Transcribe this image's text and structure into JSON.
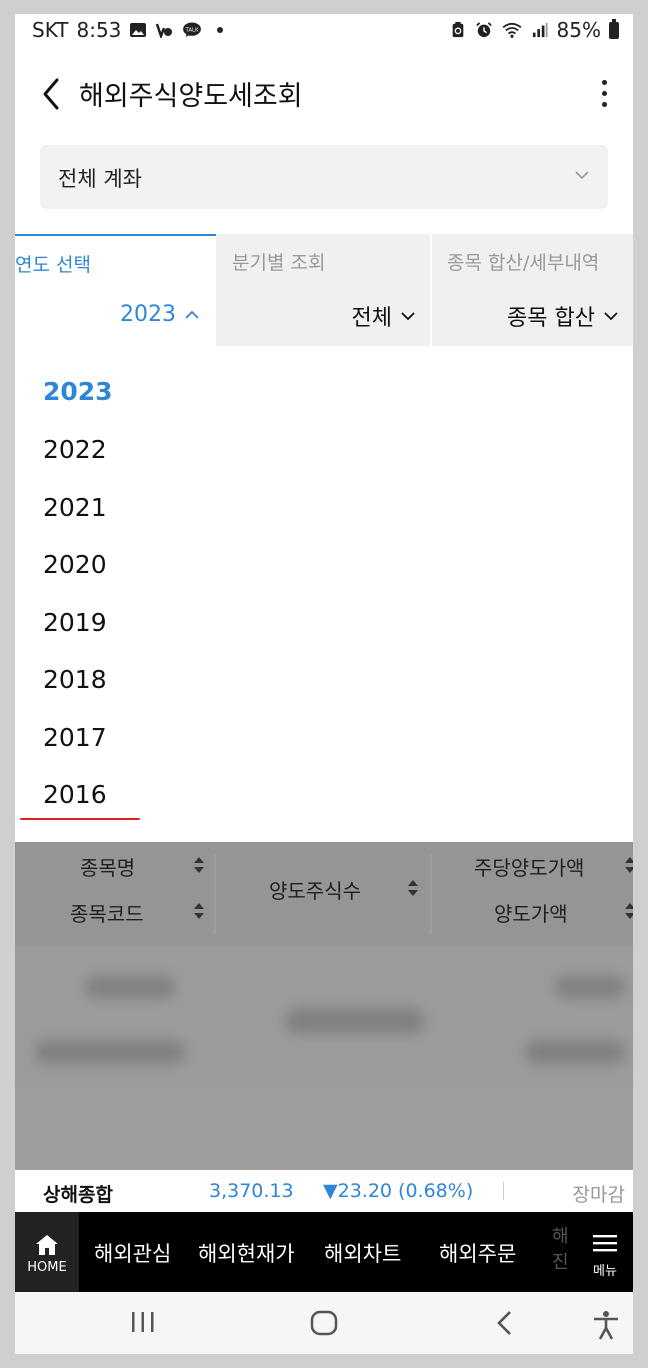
{
  "status_bar": {
    "carrier": "SKT",
    "time": "8:53",
    "battery": "85%"
  },
  "header": {
    "title": "해외주식양도세조회"
  },
  "account_select": {
    "label": "전체 계좌"
  },
  "filters": {
    "year": {
      "label": "연도 선택",
      "value": "2023"
    },
    "quarter": {
      "label": "분기별 조회",
      "value": "전체"
    },
    "item": {
      "label": "종목 합산/세부내역",
      "value": "종목 합산"
    }
  },
  "year_dropdown": {
    "selected": "2023",
    "options": [
      "2023",
      "2022",
      "2021",
      "2020",
      "2019",
      "2018",
      "2017",
      "2016"
    ]
  },
  "table": {
    "headers": {
      "name": "종목명",
      "code": "종목코드",
      "shares": "양도주식수",
      "price_per_share": "주당양도가액",
      "amount": "양도가액"
    }
  },
  "ticker": {
    "name": "상해종합",
    "value": "3,370.13",
    "change": "▼23.20 (0.68%)",
    "status": "장마감",
    "color": "#2f86d6"
  },
  "bottom_nav": {
    "home": "HOME",
    "items": [
      "해외관심",
      "해외현재가",
      "해외차트",
      "해외주문"
    ],
    "truncated": "해 진",
    "menu": "메뉴"
  },
  "colors": {
    "accent": "#2f86d6",
    "annotation_underline": "#e02020"
  }
}
